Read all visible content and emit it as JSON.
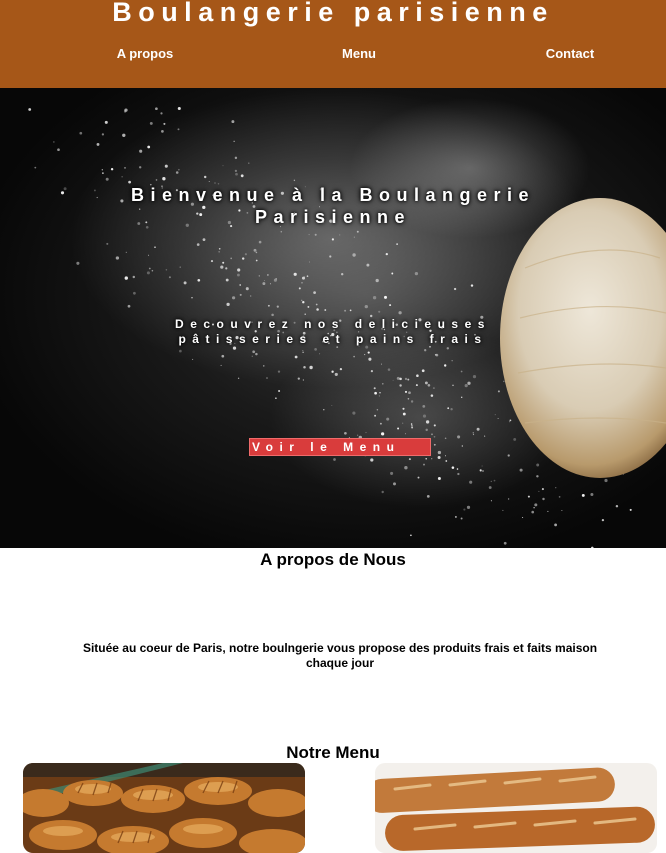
{
  "header": {
    "brand": "Boulangerie parisienne",
    "nav": [
      {
        "label": "A propos"
      },
      {
        "label": "Menu"
      },
      {
        "label": "Contact"
      }
    ],
    "bg_color": "#a65718"
  },
  "hero": {
    "title": "Bienvenue à la Boulangerie Parisienne",
    "subtitle": "Decouvrez nos delicieuses pâtisseries et pains frais",
    "cta_label": "Voir le Menu",
    "cta_color": "#d93c3c"
  },
  "about": {
    "title": "A propos de Nous",
    "text": "Située au coeur de Paris, notre boulngerie vous propose des produits frais et faits maison chaque jour"
  },
  "menu": {
    "title": "Notre Menu",
    "items": [
      {
        "image": "croissants-photo"
      },
      {
        "image": "baguettes-photo"
      }
    ]
  }
}
